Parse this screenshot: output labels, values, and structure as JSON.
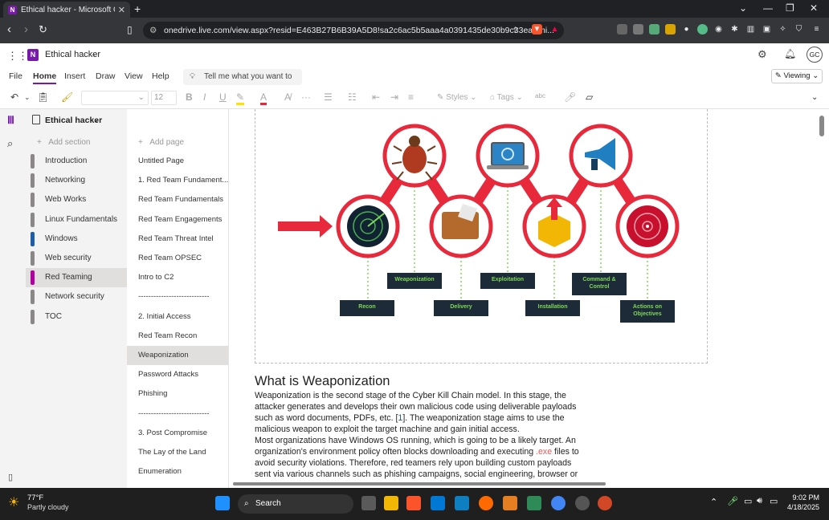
{
  "browser": {
    "tab_title": "Ethical hacker - Microsoft OneN",
    "url": "onedrive.live.com/view.aspx?resid=E463B27B6B39A5D8!sa2c6ac5b5aaa4a0391435de30b9c33ea&mi..."
  },
  "app": {
    "notebook_title": "Ethical hacker",
    "avatar": "GC",
    "menus": [
      "File",
      "Home",
      "Insert",
      "Draw",
      "View",
      "Help"
    ],
    "active_menu": "Home",
    "tell_me": "Tell me what you want to do",
    "viewing": "Viewing",
    "font_size": "12",
    "styles": "Styles",
    "tags": "Tags"
  },
  "sidebar": {
    "notebook": "Ethical hacker",
    "add_section": "Add section",
    "sections": [
      {
        "label": "Introduction",
        "color": "#8a8886"
      },
      {
        "label": "Networking",
        "color": "#8a8886"
      },
      {
        "label": "Web Works",
        "color": "#8a8886"
      },
      {
        "label": "Linux Fundamentals",
        "color": "#8a8886"
      },
      {
        "label": "Windows",
        "color": "#1c5fa8"
      },
      {
        "label": "Web security",
        "color": "#8a8886"
      },
      {
        "label": "Red Teaming",
        "color": "#b4009e"
      },
      {
        "label": "Network security",
        "color": "#8a8886"
      },
      {
        "label": "TOC",
        "color": "#8a8886"
      }
    ]
  },
  "pages": {
    "add_page": "Add page",
    "items": [
      "Untitled Page",
      "1. Red Team Fundament...",
      "Red Team Fundamentals",
      "Red Team Engagements",
      "Red Team Threat Intel",
      "Red Team OPSEC",
      "Intro to C2",
      "----------------------------",
      "2. Initial Access",
      "Red Team Recon",
      "Weaponization",
      "Password Attacks",
      "Phishing",
      "----------------------------",
      "3. Post Compromise",
      "The Lay of the Land",
      "Enumeration"
    ]
  },
  "diagram": {
    "labels": [
      "Recon",
      "Weaponization",
      "Delivery",
      "Exploitation",
      "Installation",
      "Command & Control",
      "Actions on Objectives"
    ]
  },
  "content": {
    "heading": "What is Weaponization",
    "p1_a": "Weaponization is the second stage of the Cyber Kill Chain model. In this stage, the attacker generates and develops their own malicious code using deliverable payloads such as word documents, PDFs, etc. [",
    "p1_ref": "1",
    "p1_b": "]. The weaponization stage aims to use the malicious weapon to exploit the target machine and gain initial access.",
    "p2_a": "Most organizations have Windows OS running, which is going to be a likely target. An organization's environment policy often blocks downloading and executing ",
    "p2_exe": ".exe",
    "p2_b": " files to avoid security violations. Therefore, red teamers rely upon building custom payloads sent via various channels such as phishing campaigns, social engineering, browser or"
  },
  "taskbar": {
    "temp": "77°F",
    "weather": "Partly cloudy",
    "search": "Search",
    "time": "9:02 PM",
    "date": "4/18/2025"
  },
  "colors": {
    "accent": "#7719aa",
    "kill_chain_red": "#e8293b",
    "label_bg": "#1d2a38",
    "label_text": "#7ed957"
  }
}
